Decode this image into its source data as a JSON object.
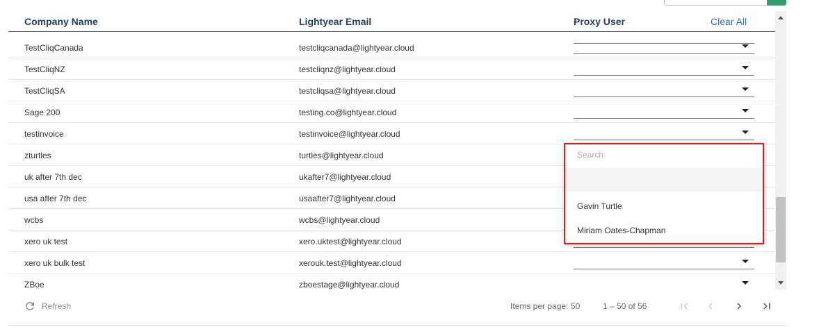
{
  "header": {
    "company_name": "Company Name",
    "lightyear_email": "Lightyear Email",
    "proxy_user": "Proxy User",
    "clear_all": "Clear All"
  },
  "rows": [
    {
      "company": "TestCliqCanada",
      "email": "testcliqcanada@lightyear.cloud"
    },
    {
      "company": "TestCliqNZ",
      "email": "testcliqnz@lightyear.cloud"
    },
    {
      "company": "TestCliqSA",
      "email": "testcliqsa@lightyear.cloud"
    },
    {
      "company": "Sage 200",
      "email": "testing.co@lightyear.cloud"
    },
    {
      "company": "testinvoice",
      "email": "testinvoice@lightyear.cloud"
    },
    {
      "company": "zturtles",
      "email": "turtles@lightyear.cloud"
    },
    {
      "company": "uk after 7th dec",
      "email": "ukafter7@lightyear.cloud"
    },
    {
      "company": "usa after 7th dec",
      "email": "usaafter7@lightyear.cloud"
    },
    {
      "company": "wcbs",
      "email": "wcbs@lightyear.cloud"
    },
    {
      "company": "xero uk test",
      "email": "xero.uktest@lightyear.cloud"
    },
    {
      "company": "xero uk bulk test",
      "email": "xerouk.test@lightyear.cloud"
    },
    {
      "company": "ZBoe",
      "email": "zboestage@lightyear.cloud"
    }
  ],
  "dropdown": {
    "search_placeholder": "Search",
    "options": [
      "Gavin Turtle",
      "Miriam Oates-Chapman"
    ]
  },
  "footer": {
    "refresh_label": "Refresh",
    "items_per_page_label": "Items per page:",
    "items_per_page_value": "50",
    "range_label": "1 – 50 of 56"
  },
  "colors": {
    "accent_link": "#2a6fb8",
    "highlight_border": "#e01b1b",
    "header_text": "#2c3e50"
  }
}
